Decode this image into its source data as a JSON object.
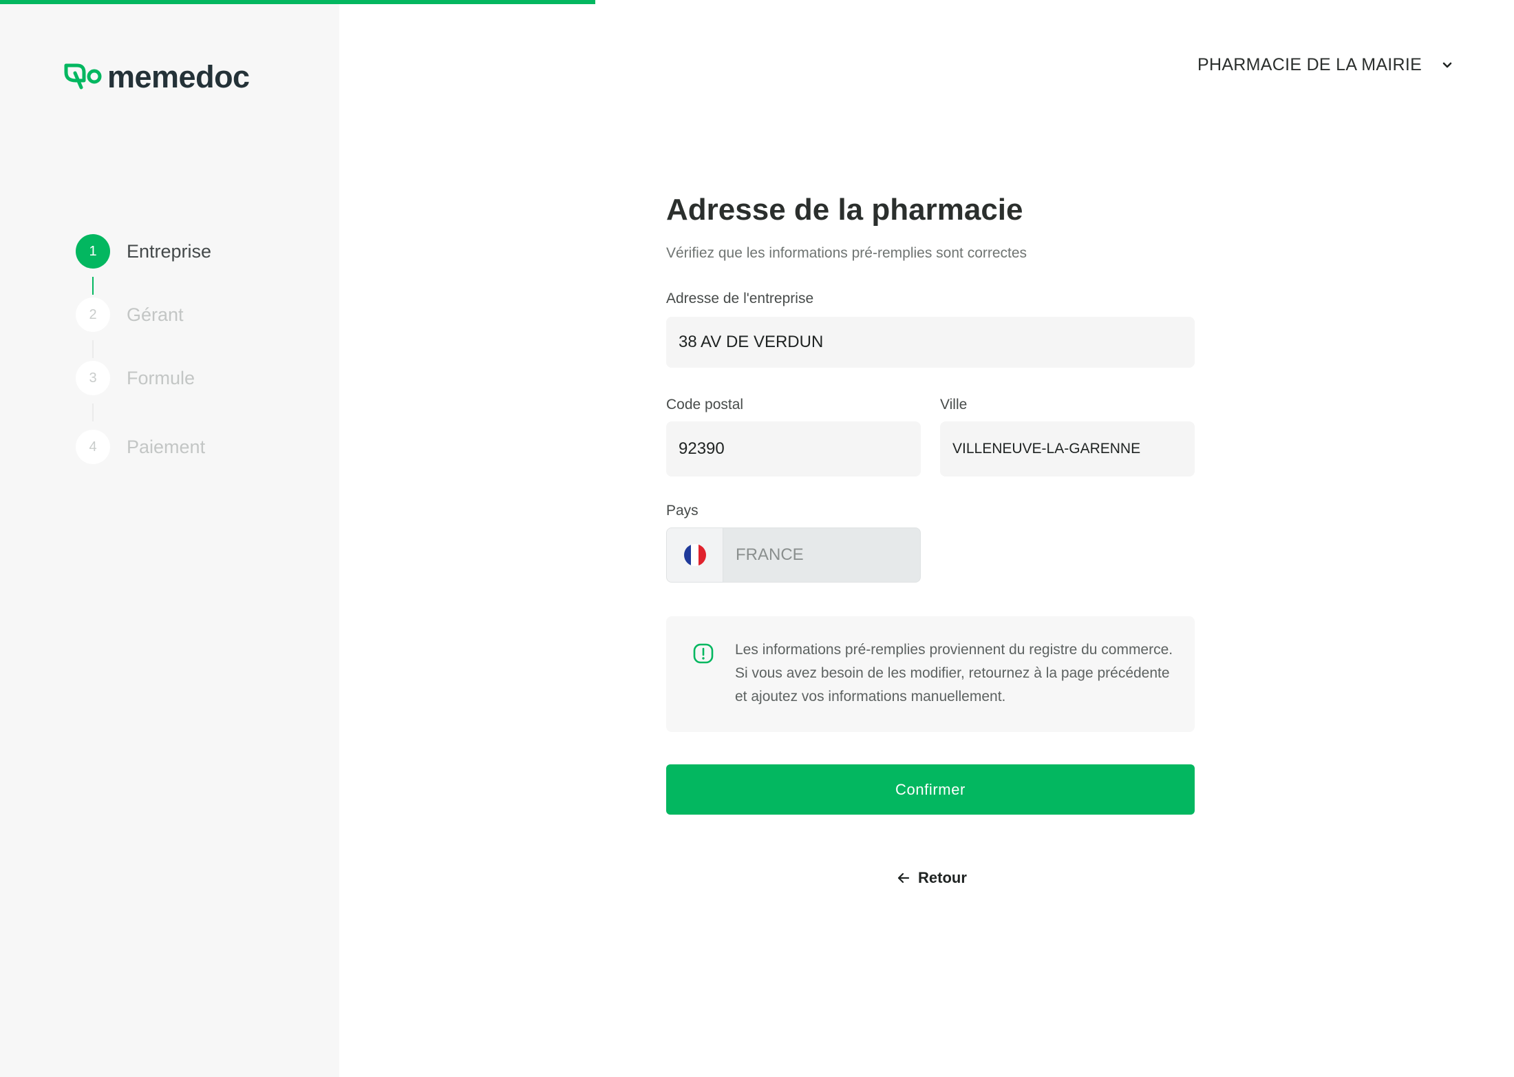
{
  "progress": {
    "fraction": 0.393
  },
  "logo": {
    "text": "memedoc"
  },
  "steps": [
    {
      "number": "1",
      "label": "Entreprise",
      "active": true
    },
    {
      "number": "2",
      "label": "Gérant",
      "active": false
    },
    {
      "number": "3",
      "label": "Formule",
      "active": false
    },
    {
      "number": "4",
      "label": "Paiement",
      "active": false
    }
  ],
  "header": {
    "pharmacy_name": "PHARMACIE DE LA MAIRIE"
  },
  "form": {
    "title": "Adresse de la pharmacie",
    "subtitle": "Vérifiez que les informations pré-remplies sont correctes",
    "address_label": "Adresse de l'entreprise",
    "address_value": "38 AV DE VERDUN",
    "postal_label": "Code postal",
    "postal_value": "92390",
    "city_label": "Ville",
    "city_value": "VILLENEUVE-LA-GARENNE",
    "country_label": "Pays",
    "country_value": "FRANCE",
    "info_text": "Les informations pré-remplies proviennent du registre du commerce. Si vous avez besoin de les modifier, retournez à la page précédente et ajoutez vos informations manuellement.",
    "confirm_label": "Confirmer",
    "back_label": "Retour"
  },
  "colors": {
    "accent": "#03b760",
    "sidebar_bg": "#f7f7f7",
    "text_dark": "#2b2f2d"
  },
  "icons": [
    "logo-icon",
    "chevron-down-icon",
    "france-flag-icon",
    "info-icon",
    "arrow-left-icon"
  ]
}
